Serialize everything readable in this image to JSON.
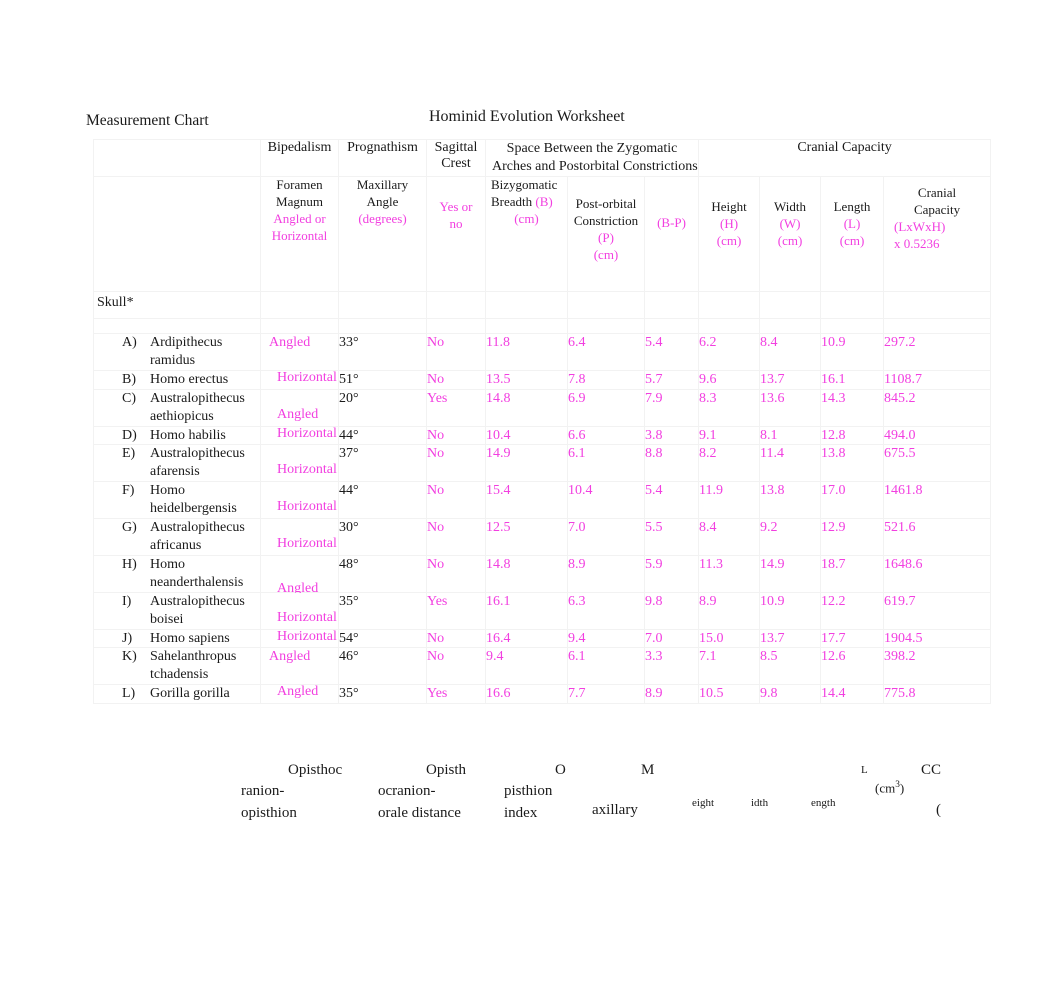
{
  "titles": {
    "measurement_chart": "Measurement Chart",
    "worksheet": "Hominid Evolution Worksheet"
  },
  "table": {
    "group_headers": {
      "blank": "",
      "bipedalism": "Bipedalism",
      "prognathism": "Prognathism",
      "sagittal_crest_l1": "Sagittal",
      "sagittal_crest_l2": "Crest",
      "space_zygomatic_l1": "Space Between the Zygomatic",
      "space_zygomatic_l2": "Arches and Postorbital Constrictions",
      "cranial_capacity": "Cranial Capacity"
    },
    "sub_headers": {
      "foramen_l1": "Foramen",
      "foramen_l2": "Magnum",
      "foramen_unit_l1": "Angled or",
      "foramen_unit_l2": "Horizontal",
      "maxillary_l1": "Maxillary",
      "maxillary_l2": "Angle",
      "maxillary_unit": "(degrees)",
      "sagittal_unit_l1": "Yes or",
      "sagittal_unit_l2": "no",
      "bizygomatic_l1": "Bizygomatic",
      "bizygomatic_l2": "Breadth ",
      "bizygomatic_sym": "(B)",
      "bizygomatic_unit": "(cm)",
      "postorbital_l1": "Post-orbital",
      "postorbital_l2": "Constriction",
      "postorbital_sym": "(P)",
      "postorbital_unit": "(cm)",
      "bminusp": "(B-P)",
      "height_l1": "Height",
      "height_sym": "(H)",
      "height_unit": "(cm)",
      "width_l1": "Width",
      "width_sym": "(W)",
      "width_unit": "(cm)",
      "length_l1": "Length",
      "length_sym": "(L)",
      "length_unit": "(cm)",
      "cranial_l1": "Cranial",
      "cranial_l2": "Capacity",
      "cranial_formula_l1": "(LxWxH)",
      "cranial_formula_l2": "x 0.5236"
    },
    "section_label": "Skull*",
    "rows": [
      {
        "letter": "A)",
        "species": "Ardipithecus ramidus",
        "bipedalism": "Angled",
        "bipedalism_align": "top",
        "maxillary_angle": "33°",
        "sagittal_crest": "No",
        "bizygomatic_breadth": "11.8",
        "postorbital_constriction": "6.4",
        "b_minus_p": "5.4",
        "height": "6.2",
        "width": "8.4",
        "length": "10.9",
        "cranial_capacity": "297.2"
      },
      {
        "letter": "B)",
        "species": "Homo erectus",
        "bipedalism": "Horizontal",
        "bipedalism_align": "bottom",
        "maxillary_angle": "51°",
        "sagittal_crest": "No",
        "bizygomatic_breadth": "13.5",
        "postorbital_constriction": "7.8",
        "b_minus_p": "5.7",
        "height": "9.6",
        "width": "13.7",
        "length": "16.1",
        "cranial_capacity": "1108.7"
      },
      {
        "letter": "C)",
        "species": "Australopithecus aethiopicus",
        "bipedalism": "Angled",
        "bipedalism_align": "bottom",
        "maxillary_angle": "20°",
        "sagittal_crest": "Yes",
        "bizygomatic_breadth": "14.8",
        "postorbital_constriction": "6.9",
        "b_minus_p": "7.9",
        "height": "8.3",
        "width": "13.6",
        "length": "14.3",
        "cranial_capacity": "845.2"
      },
      {
        "letter": "D)",
        "species": "Homo habilis",
        "bipedalism": "Horizontal",
        "bipedalism_align": "bottom",
        "maxillary_angle": "44°",
        "sagittal_crest": "No",
        "bizygomatic_breadth": "10.4",
        "postorbital_constriction": "6.6",
        "b_minus_p": "3.8",
        "height": "9.1",
        "width": "8.1",
        "length": "12.8",
        "cranial_capacity": "494.0"
      },
      {
        "letter": "E)",
        "species": "Australopithecus afarensis",
        "bipedalism": "Horizontal",
        "bipedalism_align": "bottom",
        "maxillary_angle": "37°",
        "sagittal_crest": "No",
        "bizygomatic_breadth": "14.9",
        "postorbital_constriction": "6.1",
        "b_minus_p": "8.8",
        "height": "8.2",
        "width": "11.4",
        "length": "13.8",
        "cranial_capacity": "675.5"
      },
      {
        "letter": "F)",
        "species": "Homo heidelbergensis",
        "bipedalism": "Horizontal",
        "bipedalism_align": "bottom",
        "maxillary_angle": "44°",
        "sagittal_crest": "No",
        "bizygomatic_breadth": "15.4",
        "postorbital_constriction": "10.4",
        "b_minus_p": "5.4",
        "height": "11.9",
        "width": "13.8",
        "length": "17.0",
        "cranial_capacity": "1461.8"
      },
      {
        "letter": "G)",
        "species": "Australopithecus africanus",
        "bipedalism": "Horizontal",
        "bipedalism_align": "bottom",
        "maxillary_angle": "30°",
        "sagittal_crest": "No",
        "bizygomatic_breadth": "12.5",
        "postorbital_constriction": "7.0",
        "b_minus_p": "5.5",
        "height": "8.4",
        "width": "9.2",
        "length": "12.9",
        "cranial_capacity": "521.6"
      },
      {
        "letter": "H)",
        "species": "Homo neanderthalensis",
        "bipedalism": "Angled",
        "bipedalism_align": "mid",
        "maxillary_angle": "48°",
        "sagittal_crest": "No",
        "bizygomatic_breadth": "14.8",
        "postorbital_constriction": "8.9",
        "b_minus_p": "5.9",
        "height": "11.3",
        "width": "14.9",
        "length": "18.7",
        "cranial_capacity": "1648.6"
      },
      {
        "letter": "I)",
        "species": "Australopithecus boisei",
        "bipedalism": "Horizontal",
        "bipedalism_align": "bottom",
        "maxillary_angle": "35°",
        "sagittal_crest": "Yes",
        "bizygomatic_breadth": "16.1",
        "postorbital_constriction": "6.3",
        "b_minus_p": "9.8",
        "height": "8.9",
        "width": "10.9",
        "length": "12.2",
        "cranial_capacity": "619.7"
      },
      {
        "letter": "J)",
        "species": "Homo sapiens",
        "bipedalism": "Horizontal",
        "bipedalism_align": "bottom",
        "maxillary_angle": "54°",
        "sagittal_crest": "No",
        "bizygomatic_breadth": "16.4",
        "postorbital_constriction": "9.4",
        "b_minus_p": "7.0",
        "height": "15.0",
        "width": "13.7",
        "length": "17.7",
        "cranial_capacity": "1904.5"
      },
      {
        "letter": "K)",
        "species": "Sahelanthropus tchadensis",
        "bipedalism": "Angled",
        "bipedalism_align": "top",
        "maxillary_angle": "46°",
        "sagittal_crest": "No",
        "bizygomatic_breadth": "9.4",
        "postorbital_constriction": "6.1",
        "b_minus_p": "3.3",
        "height": "7.1",
        "width": "8.5",
        "length": "12.6",
        "cranial_capacity": "398.2"
      },
      {
        "letter": "L)",
        "species": "Gorilla gorilla",
        "bipedalism": "Angled",
        "bipedalism_align": "bottom",
        "maxillary_angle": "35°",
        "sagittal_crest": "Yes",
        "bizygomatic_breadth": "16.6",
        "postorbital_constriction": "7.7",
        "b_minus_p": "8.9",
        "height": "10.5",
        "width": "9.8",
        "length": "14.4",
        "cranial_capacity": "775.8"
      }
    ]
  },
  "footer_fragments": {
    "opisthoc": "Opisthoc",
    "ranion_dash": "ranion-",
    "opisthion": "opisthion",
    "opisth": "Opisth",
    "ocranion_dash": "ocranion-",
    "orale_distance": "orale distance",
    "o_letter": "O",
    "pisthion": "pisthion",
    "index": "index",
    "m_letter": "M",
    "axillary": "axillary",
    "eight": "eight",
    "idth": "idth",
    "ength": "ength",
    "l_letter": "L",
    "cc_letter": "CC",
    "cm_cubed_prefix": "(cm",
    "cm_cubed_sup": "3",
    "cm_cubed_suffix": ")",
    "red_paren": "("
  },
  "colors": {
    "accent_pink": "#f23fe0",
    "text_black": "#1a1a1a",
    "red": "#e10000",
    "grid_line": "#f2f2f2",
    "page_background": "#ffffff"
  }
}
